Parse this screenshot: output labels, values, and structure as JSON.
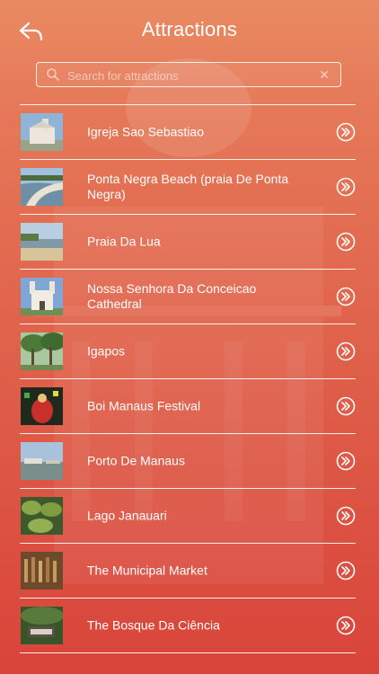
{
  "header": {
    "title": "Attractions"
  },
  "search": {
    "placeholder": "Search for attractions",
    "value": ""
  },
  "items": [
    {
      "label": "Igreja Sao Sebastiao"
    },
    {
      "label": "Ponta Negra Beach (praia De Ponta Negra)"
    },
    {
      "label": "Praia Da Lua"
    },
    {
      "label": "Nossa Senhora Da Conceicao Cathedral"
    },
    {
      "label": "Igapos"
    },
    {
      "label": "Boi Manaus Festival"
    },
    {
      "label": "Porto De Manaus"
    },
    {
      "label": "Lago Janauari"
    },
    {
      "label": "The Municipal Market"
    },
    {
      "label": "The Bosque Da Ciência"
    }
  ]
}
